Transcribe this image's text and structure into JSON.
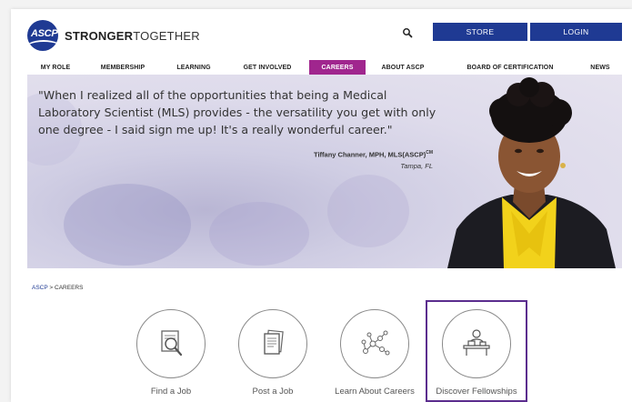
{
  "header": {
    "logo_text": "ASCP",
    "tagline_bold": "STRONGER",
    "tagline_light": "TOGETHER",
    "search_icon": "search-icon",
    "store_label": "STORE",
    "login_label": "LOGIN"
  },
  "nav": {
    "items": [
      {
        "label": "MY ROLE"
      },
      {
        "label": "MEMBERSHIP"
      },
      {
        "label": "LEARNING"
      },
      {
        "label": "GET INVOLVED"
      },
      {
        "label": "CAREERS"
      },
      {
        "label": "ABOUT ASCP"
      },
      {
        "label": "BOARD OF CERTIFICATION"
      },
      {
        "label": "NEWS"
      }
    ],
    "active": "CAREERS",
    "active_color": "#a0268e"
  },
  "hero": {
    "quote": "\"When I realized all of the opportunities that being a Medical Laboratory Scientist (MLS) provides - the versatility you get with only one degree - I said sign me up! It's a really wonderful career.\"",
    "name": "Tiffany Channer, MPH, MLS(ASCP)",
    "name_sup": "CM",
    "city": "Tampa, FL"
  },
  "breadcrumb": {
    "home": "ASCP",
    "separator": ">",
    "current": "CAREERS"
  },
  "tiles": [
    {
      "label": "Find a Job",
      "icon": "search-document-icon"
    },
    {
      "label": "Post a Job",
      "icon": "document-stack-icon"
    },
    {
      "label": "Learn About Careers",
      "icon": "molecule-network-icon"
    },
    {
      "label": "Discover Fellowships",
      "icon": "person-at-desk-icon"
    }
  ],
  "colors": {
    "brand_blue": "#1f3a93",
    "careers_magenta": "#a0268e",
    "highlight_purple": "#5b2d8e"
  }
}
